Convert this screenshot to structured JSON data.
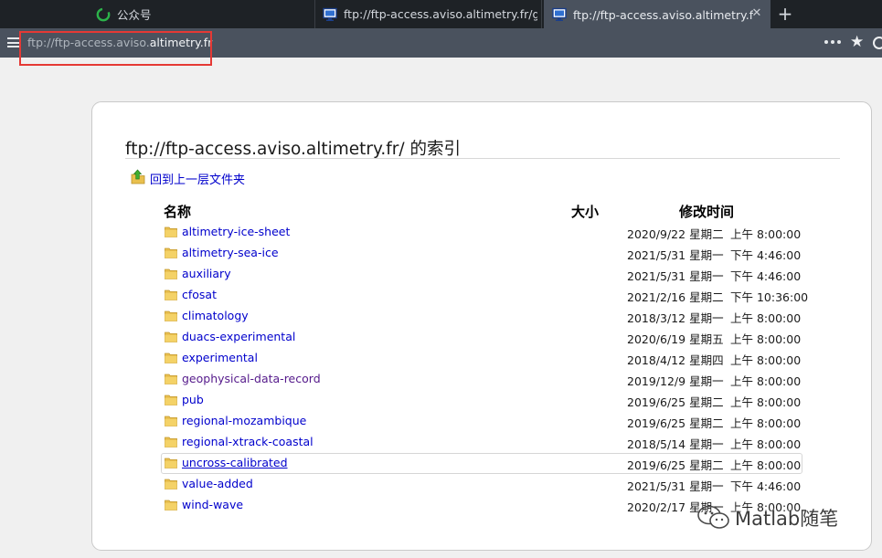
{
  "tabs": [
    {
      "title": "公众号",
      "favicon": "wechat-green-icon",
      "active": false
    },
    {
      "title": "ftp://ftp-access.aviso.altimetry.fr/geoph",
      "favicon": "monitor-page-icon",
      "active": false
    },
    {
      "title": "ftp://ftp-access.aviso.altimetry.fr/ 的",
      "favicon": "monitor-page-icon",
      "active": true
    }
  ],
  "tab_close_glyph": "✕",
  "new_tab_glyph": "+",
  "navbar": {
    "url_scheme": "ftp://ftp-access.aviso.",
    "url_host": "altimetry.fr",
    "menu_icon": "hamburger-menu-icon",
    "more_icon": "more-dots-icon",
    "star_icon": "bookmark-star-icon",
    "star_glyph": "★",
    "highlight_color": "#e53935"
  },
  "page": {
    "title": "ftp://ftp-access.aviso.altimetry.fr/ 的索引",
    "up_link": "回到上一层文件夹",
    "columns": {
      "name": "名称",
      "size": "大小",
      "modified": "修改时间"
    },
    "entries": [
      {
        "name": "altimetry-ice-sheet",
        "date": "2020/9/22 星期二",
        "time": "上午 8:00:00"
      },
      {
        "name": "altimetry-sea-ice",
        "date": "2021/5/31 星期一",
        "time": "下午 4:46:00"
      },
      {
        "name": "auxiliary",
        "date": "2021/5/31 星期一",
        "time": "下午 4:46:00"
      },
      {
        "name": "cfosat",
        "date": "2021/2/16 星期二",
        "time": "下午 10:36:00"
      },
      {
        "name": "climatology",
        "date": "2018/3/12 星期一",
        "time": "上午 8:00:00"
      },
      {
        "name": "duacs-experimental",
        "date": "2020/6/19 星期五",
        "time": "上午 8:00:00"
      },
      {
        "name": "experimental",
        "date": "2018/4/12 星期四",
        "time": "上午 8:00:00"
      },
      {
        "name": "geophysical-data-record",
        "date": "2019/12/9 星期一",
        "time": "上午 8:00:00",
        "visited": true
      },
      {
        "name": "pub",
        "date": "2019/6/25 星期二",
        "time": "上午 8:00:00"
      },
      {
        "name": "regional-mozambique",
        "date": "2019/6/25 星期二",
        "time": "上午 8:00:00"
      },
      {
        "name": "regional-xtrack-coastal",
        "date": "2018/5/14 星期一",
        "time": "上午 8:00:00"
      },
      {
        "name": "uncross-calibrated",
        "date": "2019/6/25 星期二",
        "time": "上午 8:00:00",
        "hovered": true
      },
      {
        "name": "value-added",
        "date": "2021/5/31 星期一",
        "time": "下午 4:46:00"
      },
      {
        "name": "wind-wave",
        "date": "2020/2/17 星期一",
        "time": "上午 8:00:00"
      }
    ]
  },
  "watermark": {
    "text": "Matlab随笔",
    "icon": "wechat-logo-icon"
  },
  "colors": {
    "link": "#0000cc",
    "visited_link": "#551a8b",
    "tab_bar": "#1e2226",
    "nav_bar": "#4a525e"
  }
}
